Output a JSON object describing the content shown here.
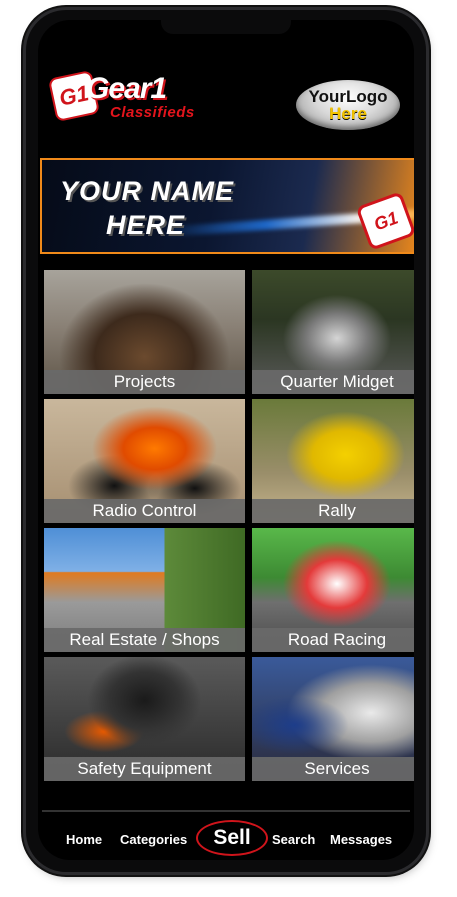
{
  "header": {
    "logo_badge": "G1",
    "logo_title": "Gear1",
    "logo_subtitle": "Classifieds",
    "your_logo_line1": "YourLogo",
    "your_logo_line2": "Here"
  },
  "banner": {
    "line1": "YOUR NAME",
    "line2": "HERE",
    "badge": "G1",
    "accent_color": "#f08a1a"
  },
  "categories": [
    {
      "label": "Projects",
      "image": "rusty-vintage-car"
    },
    {
      "label": "Quarter Midget",
      "image": "quarter-midget-racer"
    },
    {
      "label": "Radio Control",
      "image": "rc-monster-truck"
    },
    {
      "label": "Rally",
      "image": "yellow-rally-car"
    },
    {
      "label": "Real Estate / Shops",
      "image": "commercial-building"
    },
    {
      "label": "Road Racing",
      "image": "race-car-on-track"
    },
    {
      "label": "Safety Equipment",
      "image": "driver-in-helmet"
    },
    {
      "label": "Services",
      "image": "mechanic-at-work"
    }
  ],
  "nav": {
    "home": "Home",
    "categories": "Categories",
    "sell": "Sell",
    "search": "Search",
    "messages": "Messages",
    "sell_ring_color": "#d0141b"
  }
}
